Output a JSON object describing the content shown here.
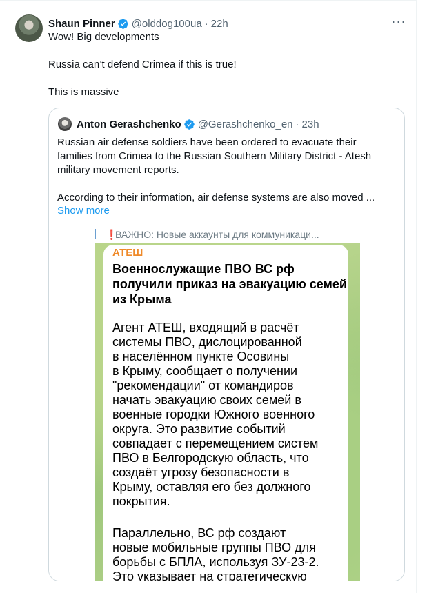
{
  "tweet": {
    "author_name": "Shaun Pinner",
    "handle": "@olddog100ua",
    "separator": "·",
    "time": "22h",
    "more_label": "···",
    "lines": [
      "Wow! Big developments",
      "Russia can’t defend Crimea if this is true!",
      "This is massive"
    ]
  },
  "quote": {
    "author_name": "Anton Gerashchenko",
    "handle": "@Gerashchenko_en",
    "separator": "·",
    "time": "23h",
    "paragraph1": [
      "Russian air defense soldiers have been ordered to evacuate their",
      "families from Crimea to the Russian Southern Military District - Atesh",
      "military movement reports."
    ],
    "paragraph2": "According to their information, air defense systems are also moved ...",
    "show_more": "Show more"
  },
  "media": {
    "telegram_header": "ВАЖНО: Новые аккаунты для коммуникаци...",
    "telegram_excl": "❗",
    "channel": "АТЕШ",
    "heading_lines": [
      "Военнослужащие ПВО ВС рф",
      "получили приказ на эвакуацию семей",
      "из Крыма"
    ],
    "body_lines": [
      "Агент АТЕШ, входящий в расчёт",
      "системы ПВО, дислоцированной",
      "в населённом пункте Осовины",
      "в Крыму, сообщает о получении",
      "\"рекомендации\" от командиров",
      "начать эвакуацию своих семей в",
      "военные городки Южного военного",
      "округа. Это развитие событий",
      "совпадает с перемещением систем",
      "ПВО в Белгородскую область, что",
      "создаёт угрозу безопасности в",
      "Крыму, оставляя его без должного",
      "покрытия."
    ],
    "para2_lines": [
      "Параллельно, ВС рф создают",
      "новые мобильные группы ПВО для",
      "борьбы с БПЛА, используя ЗУ-23-2.",
      "Это указывает на стратегическую"
    ]
  },
  "colors": {
    "verified": "#1d9bf0",
    "link": "#1d9bf0",
    "channel": "#ef8a2a",
    "muted": "#536471"
  },
  "icons": {
    "verified": "verified-badge-icon",
    "more": "more-options-icon"
  }
}
